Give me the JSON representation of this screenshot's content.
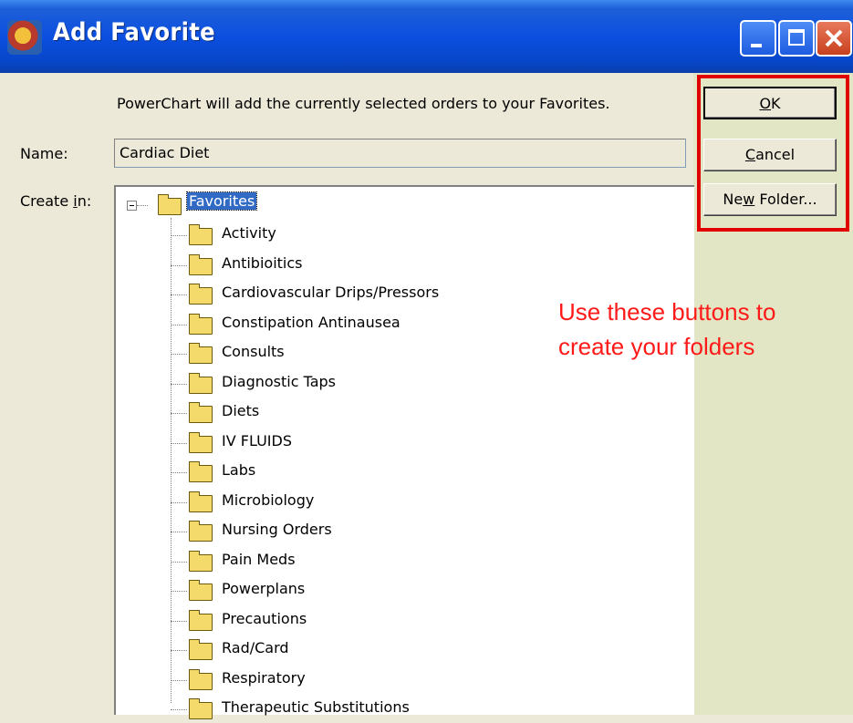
{
  "window": {
    "title": "Add Favorite",
    "controls": [
      "minimize-icon",
      "maximize-icon",
      "close-icon"
    ]
  },
  "dialog": {
    "description": "PowerChart will add the currently selected orders to your Favorites.",
    "name_label": "Name:",
    "name_value": "Cardiac Diet",
    "create_in_label_prefix": "Create ",
    "create_in_label_mnemonic": "i",
    "create_in_label_suffix": "n:"
  },
  "buttons": {
    "ok_mnemonic": "O",
    "ok_rest": "K",
    "cancel_mnemonic": "C",
    "cancel_rest": "ancel",
    "new_folder_prefix": "Ne",
    "new_folder_mnemonic": "w",
    "new_folder_rest": " Folder..."
  },
  "tree": {
    "root": "Favorites",
    "items": [
      "Activity",
      "Antibioitics",
      "Cardiovascular Drips/Pressors",
      "Constipation Antinausea",
      "Consults",
      "Diagnostic Taps",
      "Diets",
      "IV FLUIDS",
      "Labs",
      "Microbiology",
      "Nursing Orders",
      "Pain Meds",
      "Powerplans",
      "Precautions",
      "Rad/Card",
      "Respiratory",
      "Therapeutic Substitutions"
    ]
  },
  "annotation": {
    "line1": "Use these buttons to",
    "line2": "create your folders",
    "color": "#ff1a1a"
  },
  "colors": {
    "titlebar": "#0b4fe0",
    "highlight_box": "#e00000",
    "selection": "#316ac5"
  }
}
